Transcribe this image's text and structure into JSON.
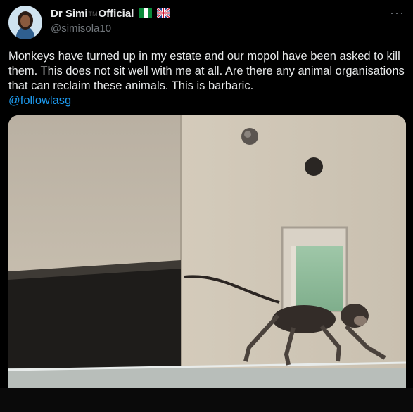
{
  "author": {
    "name_part1": "Dr Simi",
    "tm": "TM",
    "name_part2": "Official",
    "handle": "@simisola10",
    "flags": [
      "nigeria-flag",
      "uk-flag"
    ]
  },
  "more_menu": "···",
  "tweet": {
    "text": "Monkeys have turned up in my estate and our mopol have been asked to kill them. This does not sit well with me at all. Are there any animal organisations that can reclaim these animals. This is barbaric.",
    "mention": "@followlasg"
  },
  "colors": {
    "background": "#000000",
    "text": "#e7e9ea",
    "secondary": "#71767b",
    "link": "#1d9bf0"
  }
}
